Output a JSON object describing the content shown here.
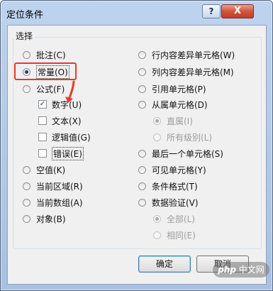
{
  "dialog": {
    "title": "定位条件",
    "help_label": "?",
    "close_label": "X"
  },
  "group": {
    "legend": "选择"
  },
  "left_options": [
    {
      "label": "批注(C)"
    },
    {
      "label": "常量(O)"
    },
    {
      "label": "公式(F)"
    },
    {
      "label": "数字(U)"
    },
    {
      "label": "文本(X)"
    },
    {
      "label": "逻辑值(G)"
    },
    {
      "label": "错误(E)"
    },
    {
      "label": "空值(K)"
    },
    {
      "label": "当前区域(R)"
    },
    {
      "label": "当前数组(A)"
    },
    {
      "label": "对象(B)"
    }
  ],
  "right_options": [
    {
      "label": "行内容差异单元格(W)"
    },
    {
      "label": "列内容差异单元格(M)"
    },
    {
      "label": "引用单元格(P)"
    },
    {
      "label": "从属单元格(D)"
    },
    {
      "label": "直属(I)"
    },
    {
      "label": "所有级别(L)"
    },
    {
      "label": "最后一个单元格(S)"
    },
    {
      "label": "可见单元格(Y)"
    },
    {
      "label": "条件格式(T)"
    },
    {
      "label": "数据验证(V)"
    },
    {
      "label": "全部(L)"
    },
    {
      "label": "相同(E)"
    }
  ],
  "buttons": {
    "ok": "确定",
    "cancel": "取消"
  },
  "watermark": {
    "brand": "php",
    "text": "中文网"
  },
  "colors": {
    "highlight": "#e53b2d",
    "titlebar": "#a7c1e3",
    "close": "#c13d25"
  }
}
